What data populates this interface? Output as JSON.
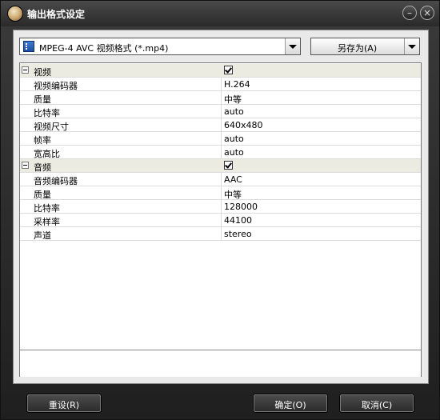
{
  "window": {
    "title": "输出格式设定",
    "minimize_glyph": "–",
    "close_glyph": "×"
  },
  "format": {
    "selected": "MPEG-4 AVC 视频格式 (*.mp4)",
    "icon": "video-format-icon"
  },
  "save_as": {
    "label": "另存为(A)"
  },
  "video": {
    "category": "视频",
    "checked": true,
    "rows": [
      {
        "name": "视频编码器",
        "value": "H.264"
      },
      {
        "name": "质量",
        "value": "中等"
      },
      {
        "name": "比特率",
        "value": "auto"
      },
      {
        "name": "视频尺寸",
        "value": "640x480"
      },
      {
        "name": "帧率",
        "value": "auto"
      },
      {
        "name": "宽高比",
        "value": "auto"
      }
    ]
  },
  "audio": {
    "category": "音频",
    "checked": true,
    "rows": [
      {
        "name": "音频编码器",
        "value": "AAC"
      },
      {
        "name": "质量",
        "value": "中等"
      },
      {
        "name": "比特率",
        "value": "128000"
      },
      {
        "name": "采样率",
        "value": "44100"
      },
      {
        "name": "声道",
        "value": "stereo"
      }
    ]
  },
  "buttons": {
    "reset": "重设(R)",
    "ok": "确定(O)",
    "cancel": "取消(C)"
  }
}
